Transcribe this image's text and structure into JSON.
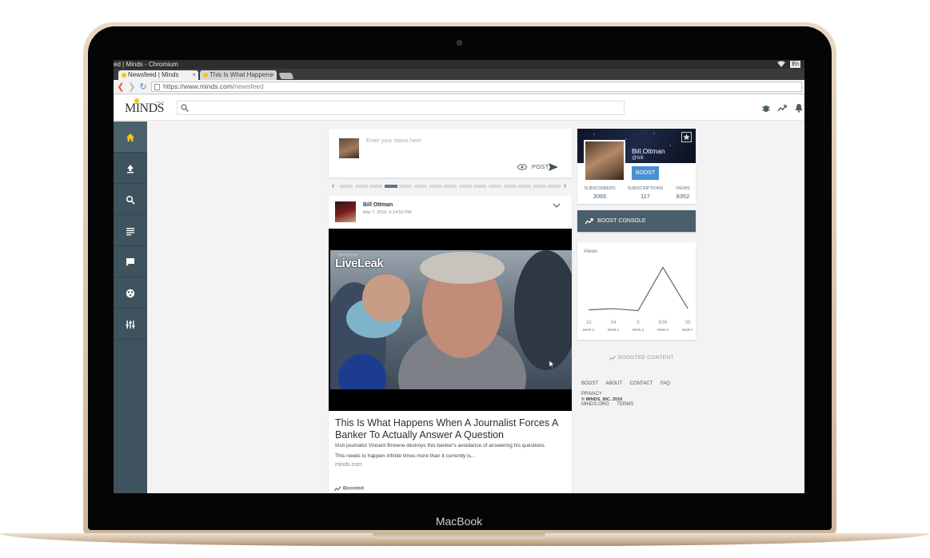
{
  "os": {
    "window_title": "ed | Minds - Chromium",
    "lang": "En"
  },
  "browser": {
    "tabs": [
      {
        "label": "Newsfeed | Minds",
        "close": "×"
      },
      {
        "label": "This Is What Happens",
        "close": "×"
      }
    ],
    "url_host": "https://www.minds.com",
    "url_path": "/newsfeed"
  },
  "header": {
    "logo": "MINDS",
    "logo_badge": "BETA"
  },
  "composer": {
    "placeholder": "Enter your status here",
    "post_label": "POST"
  },
  "rotator": {
    "segments": 15,
    "active_index": 3,
    "prev": "‹",
    "next": "›"
  },
  "post": {
    "owner": "Bill Ottman",
    "date": "Mar 7, 2016, 6:14:50 PM",
    "video_watermark": "LiveLeak",
    "video_watermark_sub": "HOSTED ON",
    "title": "This Is What Happens When A Journalist Forces A Banker To Actually Answer A Question",
    "description": "Irish journalist Vincent Browne destroys this banker's avoidance of answering his questions.",
    "description2": "This needs to happen infinite times more than it currently is...",
    "link": "minds.com",
    "boosted_label": "Boosted"
  },
  "profile": {
    "name": "Bill Ottman",
    "handle": "@bill",
    "boost_button": "BOOST",
    "stats": [
      {
        "label": "SUBSCRIBERS",
        "value": "3065"
      },
      {
        "label": "SUBSCRIPTIONS",
        "value": "117"
      },
      {
        "label": "VIEWS",
        "value": "8352"
      }
    ]
  },
  "boost_console": {
    "label": "BOOST CONSOLE"
  },
  "views": {
    "title": "Views",
    "chart_data": {
      "type": "line",
      "categories": [
        "MAR 2",
        "MAR 3",
        "MAR 4",
        "MAR 5",
        "MAR 6"
      ],
      "series": [
        {
          "values": [
            16,
            34,
            5,
            636,
            36
          ]
        }
      ],
      "ylim": [
        0,
        700
      ]
    }
  },
  "boosted_content": {
    "label": "BOOSTED CONTENT"
  },
  "footer": {
    "links": [
      "BOOST",
      "ABOUT",
      "CONTACT",
      "FAQ",
      "PRIVACY",
      "MINDS.ORG",
      "TERMS"
    ],
    "copyright": "© MINDS, INC. 2016"
  },
  "device": {
    "label": "MacBook"
  },
  "colors": {
    "sidebar": "#3f535e",
    "boost_blue": "#4690d3",
    "console": "#4a5e6b",
    "accent_yellow": "#f5c518"
  },
  "icons": {
    "sidebar": [
      "home-icon",
      "upload-icon",
      "search-icon",
      "newsfeed-icon",
      "chat-icon",
      "groups-icon",
      "settings-sliders-icon"
    ],
    "header": [
      "search-icon",
      "bug-icon",
      "trending-icon",
      "bell-icon"
    ]
  }
}
